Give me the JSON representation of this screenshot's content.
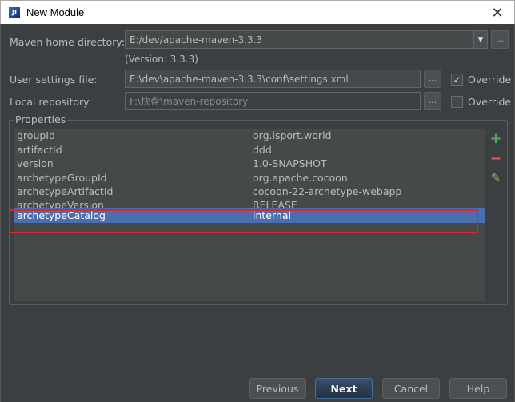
{
  "window": {
    "title": "New Module",
    "app_icon_text": "JI",
    "close_glyph": "✕"
  },
  "maven_home": {
    "label": "Maven home directory:",
    "value": "E:/dev/apache-maven-3.3.3",
    "version": "(Version: 3.3.3)"
  },
  "user_settings": {
    "label": "User settings file:",
    "value": "E:\\dev\\apache-maven-3.3.3\\conf\\settings.xml",
    "override_label": "Override",
    "override_checked": true
  },
  "local_repo": {
    "label": "Local repository:",
    "value": "F:\\快盘\\maven-repository",
    "override_label": "Override",
    "override_checked": false
  },
  "browse_glyph": "...",
  "check_glyph": "✓",
  "properties": {
    "title": "Properties",
    "rows": [
      {
        "key": "groupId",
        "value": "org.isport.world"
      },
      {
        "key": "artifactId",
        "value": "ddd"
      },
      {
        "key": "version",
        "value": "1.0-SNAPSHOT"
      },
      {
        "key": "archetypeGroupId",
        "value": "org.apache.cocoon"
      },
      {
        "key": "archetypeArtifactId",
        "value": "cocoon-22-archetype-webapp"
      },
      {
        "key": "archetypeVersion",
        "value": "RELEASE"
      },
      {
        "key": "archetypeCatalog",
        "value": "internal"
      }
    ],
    "selected_index": 6,
    "tools": {
      "add": "+",
      "remove": "−",
      "edit": "✎"
    }
  },
  "buttons": {
    "previous": "Previous",
    "next": "Next",
    "cancel": "Cancel",
    "help": "Help"
  },
  "colors": {
    "background": "#3c3f41",
    "selection": "#4b6eaf",
    "highlight_box": "#e0242b",
    "add_icon": "#59a869",
    "remove_icon": "#e05555",
    "edit_icon": "#7fc46a"
  }
}
